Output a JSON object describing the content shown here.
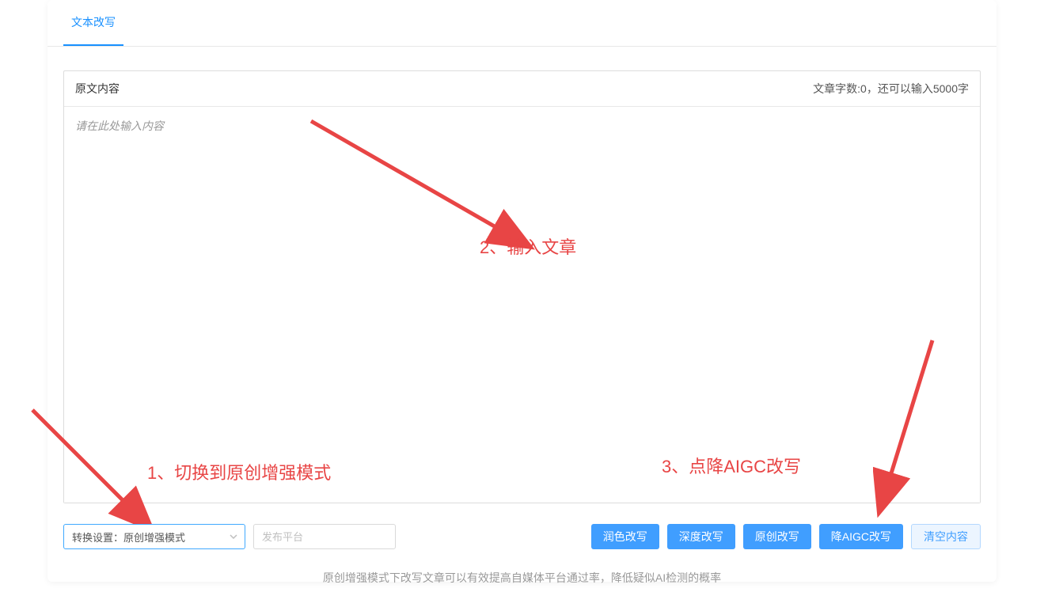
{
  "tabs": {
    "active": "文本改写"
  },
  "textbox": {
    "header_label": "原文内容",
    "counter_text": "文章字数:0，还可以输入5000字",
    "placeholder": "请在此处输入内容"
  },
  "annotations": {
    "step1": "1、切换到原创增强模式",
    "step2": "2、输入文章",
    "step3": "3、点降AIGC改写"
  },
  "bottom": {
    "select_text": "转换设置：原创增强模式",
    "platform_placeholder": "发布平台",
    "btn_polish": "润色改写",
    "btn_deep": "深度改写",
    "btn_original": "原创改写",
    "btn_aigc": "降AIGC改写",
    "btn_clear": "清空内容"
  },
  "footer": {
    "text": "原创增强模式下改写文章可以有效提高自媒体平台通过率，降低疑似AI检测的概率"
  }
}
